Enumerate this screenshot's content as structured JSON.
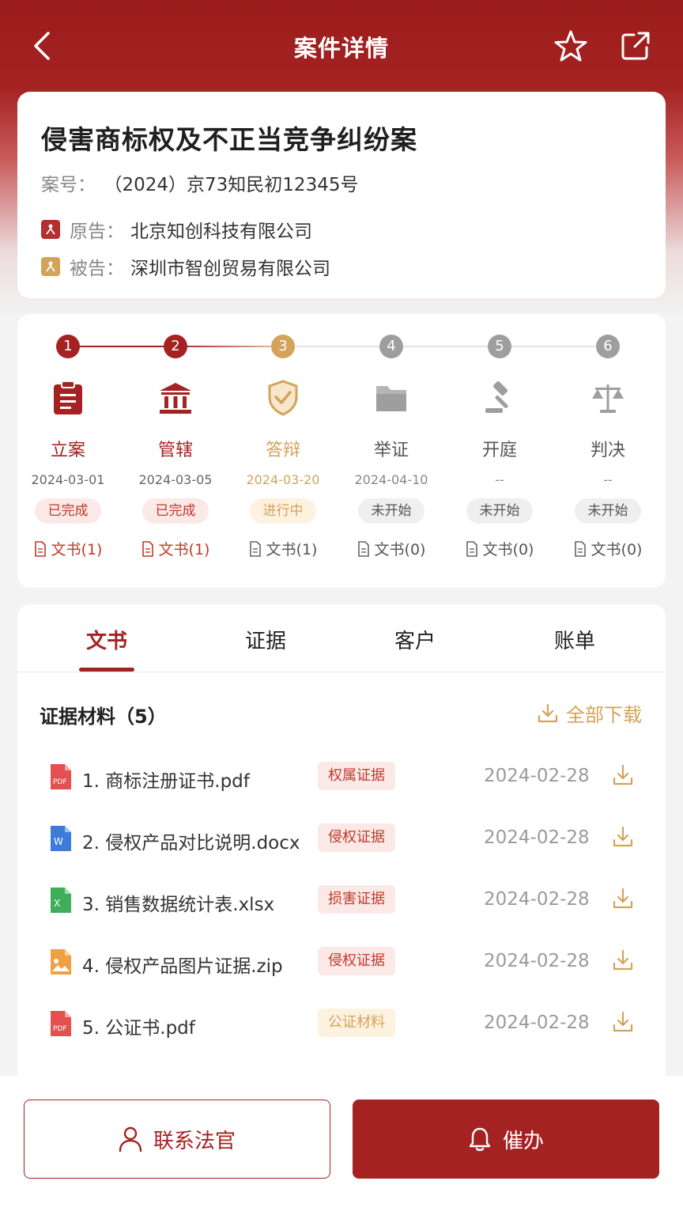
{
  "header": {
    "title": "案件详情"
  },
  "case": {
    "title": "侵害商标权及不正当竞争纠纷案",
    "case_no_label": "案号：",
    "case_no": "（2024）京73知民初12345号",
    "plaintiff_label": "原告：",
    "plaintiff": "北京知创科技有限公司",
    "defendant_label": "被告：",
    "defendant": "深圳市智创贸易有限公司"
  },
  "progress": {
    "stages": [
      {
        "num": "1",
        "name": "立案",
        "date": "2024-03-01",
        "status": "已完成",
        "docs": "文书(1)",
        "icon": "clipboard-icon"
      },
      {
        "num": "2",
        "name": "管辖",
        "date": "2024-03-05",
        "status": "已完成",
        "docs": "文书(1)",
        "icon": "courthouse-icon"
      },
      {
        "num": "3",
        "name": "答辩",
        "date": "2024-03-20",
        "status": "进行中",
        "docs": "文书(1)",
        "icon": "shield-icon"
      },
      {
        "num": "4",
        "name": "举证",
        "date": "2024-04-10",
        "status": "未开始",
        "docs": "文书(0)",
        "icon": "folder-icon"
      },
      {
        "num": "5",
        "name": "开庭",
        "date": "--",
        "status": "未开始",
        "docs": "文书(0)",
        "icon": "gavel-icon"
      },
      {
        "num": "6",
        "name": "判决",
        "date": "--",
        "status": "未开始",
        "docs": "文书(0)",
        "icon": "scales-icon"
      }
    ]
  },
  "tabs": [
    "文书",
    "证据",
    "客户",
    "账单"
  ],
  "evidence": {
    "title": "证据材料（5）",
    "download_all": "全部下载",
    "files": [
      {
        "name": "1. 商标注册证书.pdf",
        "tag": "权属证据",
        "date": "2024-02-28",
        "type": "pdf"
      },
      {
        "name": "2. 侵权产品对比说明.docx",
        "tag": "侵权证据",
        "date": "2024-02-28",
        "type": "word"
      },
      {
        "name": "3. 销售数据统计表.xlsx",
        "tag": "损害证据",
        "date": "2024-02-28",
        "type": "excel"
      },
      {
        "name": "4. 侵权产品图片证据.zip",
        "tag": "侵权证据",
        "date": "2024-02-28",
        "type": "image"
      },
      {
        "name": "5. 公证书.pdf",
        "tag": "公证材料",
        "date": "2024-02-28",
        "type": "pdf"
      }
    ]
  },
  "actions": {
    "contact": "联系法官",
    "urge": "催办"
  },
  "colors": {
    "primary": "#a52222",
    "active": "#d4a35a",
    "inactive": "#9e9e9e"
  }
}
